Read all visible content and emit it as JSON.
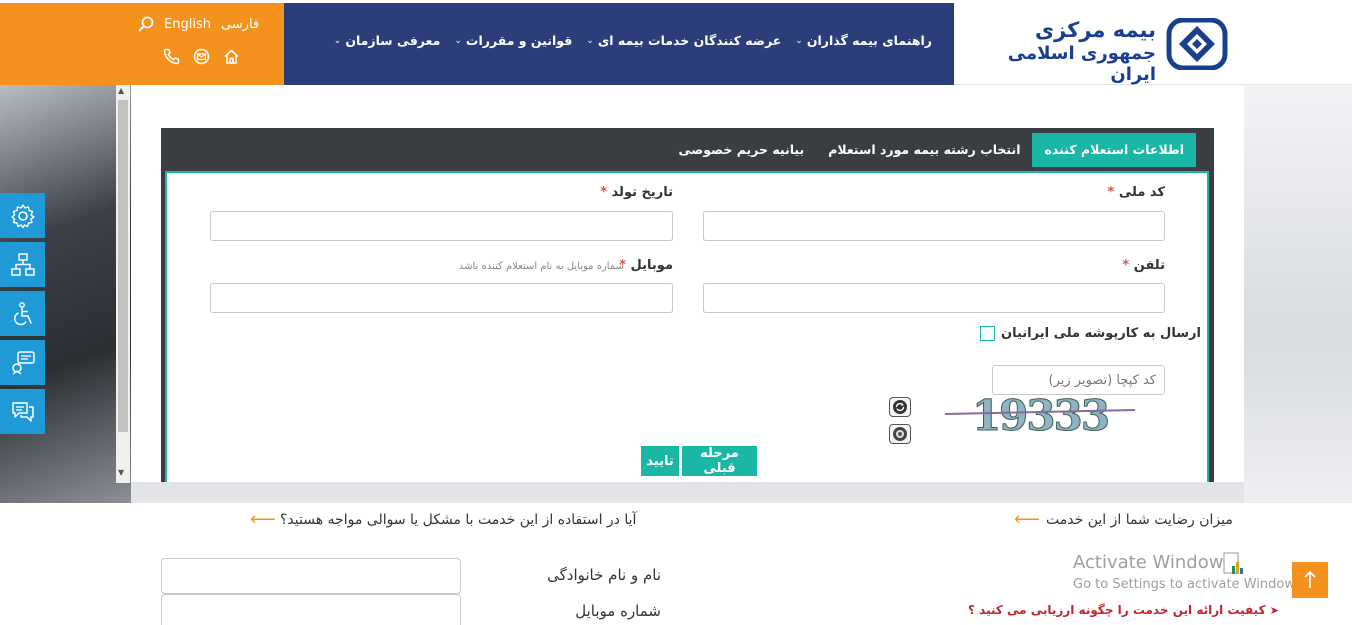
{
  "header": {
    "logo_line1": "بیمه مرکزی",
    "logo_line2": "جمهوری اسلامی ایران",
    "nav": [
      {
        "label": "معرفی سازمان"
      },
      {
        "label": "قوانین و مقررات"
      },
      {
        "label": "عرضه کنندگان خدمات بیمه ای"
      },
      {
        "label": "راهنمای بیمه گذاران"
      }
    ],
    "lang_fa": "فارسی",
    "lang_en": "English",
    "colors": {
      "navbar": "#2c3e7a",
      "orange": "#f5921e",
      "logo_blue": "#1b3f8f"
    }
  },
  "side_tools": [
    "gear-icon",
    "sitemap-icon",
    "accessibility-icon",
    "feedback-icon",
    "chat-icon"
  ],
  "tabs": [
    {
      "label": "بیانیه حریم خصوصی",
      "active": false
    },
    {
      "label": "انتخاب رشته بیمه مورد استعلام",
      "active": false
    },
    {
      "label": "اطلاعات استعلام کننده",
      "active": true
    }
  ],
  "form": {
    "national_code_label": "کد ملی",
    "birth_date_label": "تاریخ تولد",
    "phone_label": "تلفن",
    "mobile_label": "موبایل",
    "mobile_hint": "شماره موبایل به نام استعلام کننده باشد",
    "required_mark": "*",
    "checkbox_label": "ارسال به کارپوشه ملی ایرانیان",
    "captcha_placeholder": "کد کپچا (تصویر زیر)",
    "captcha_text": "19333",
    "prev_button": "مرحله قبلی",
    "confirm_button": "تایید",
    "accent_color": "#1ab7a6"
  },
  "bottom": {
    "satisfaction_title": "میزان رضایت شما از این خدمت",
    "problem_question": "آیا در استفاده از این خدمت با مشکل یا سوالی مواجه هستید؟",
    "name_label": "نام و نام خانوادگی",
    "mobile_label": "شماره موبایل",
    "quality_question": "کیفیت ارائه این خدمت را چگونه ارزیابی می کنید ؟",
    "activate_title": "Activate Windows",
    "activate_sub": "Go to Settings to activate Windows."
  }
}
